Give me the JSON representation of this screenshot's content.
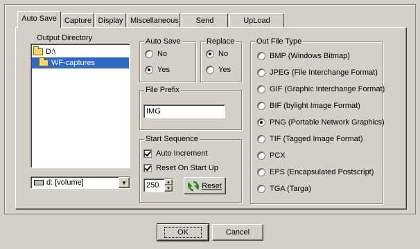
{
  "tabs": [
    "Auto Save",
    "Capture",
    "Display",
    "Miscellaneous",
    "Send Image",
    "UpLoad Image"
  ],
  "output_directory": {
    "label": "Output Directory",
    "items": [
      "D:\\",
      "WF-captures"
    ],
    "drive_select": "d: [volume]"
  },
  "auto_save": {
    "label": "Auto Save",
    "options": [
      "No",
      "Yes"
    ],
    "selected": "Yes"
  },
  "replace": {
    "label": "Replace",
    "options": [
      "No",
      "Yes"
    ],
    "selected": "No"
  },
  "file_prefix": {
    "label": "File Prefix",
    "value": "IMG"
  },
  "start_sequence": {
    "label": "Start Sequence",
    "auto_increment": "Auto Increment",
    "reset_on_start_up": "Reset On Start Up",
    "value": "250",
    "reset_button": "Reset"
  },
  "out_file_type": {
    "label": "Out File Type",
    "options": [
      "BMP (Windows Bitmap)",
      "JPEG (File Interchange Format)",
      "GIF (Graphic Interchange Format)",
      "BIF (bylight Image Format)",
      "PNG (Portable Network Graphics)",
      "TIF (Tagged Image Format)",
      "PCX",
      "EPS (Encapsulated Postscript)",
      "TGA (Targa)"
    ],
    "selected": "PNG (Portable Network Graphics)"
  },
  "buttons": {
    "ok": "OK",
    "cancel": "Cancel"
  }
}
